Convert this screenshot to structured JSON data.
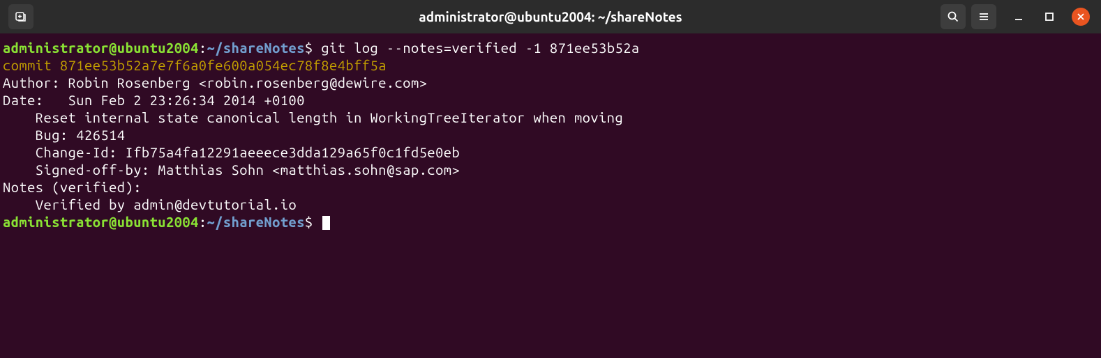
{
  "titlebar": {
    "title": "administrator@ubuntu2004: ~/shareNotes"
  },
  "prompt": {
    "user_host": "administrator@ubuntu2004",
    "colon": ":",
    "path": "~/shareNotes",
    "dollar": "$"
  },
  "command": " git log --notes=verified -1 871ee53b52a",
  "output": {
    "commit": "commit 871ee53b52a7e7f6a0fe600a054ec78f8e4bff5a",
    "author": "Author: Robin Rosenberg <robin.rosenberg@dewire.com>",
    "date": "Date:   Sun Feb 2 23:26:34 2014 +0100",
    "blank1": "",
    "msg1": "    Reset internal state canonical length in WorkingTreeIterator when moving",
    "blank2": "",
    "msg2": "    Bug: 426514",
    "msg3": "    Change-Id: Ifb75a4fa12291aeeece3dda129a65f0c1fd5e0eb",
    "msg4": "    Signed-off-by: Matthias Sohn <matthias.sohn@sap.com>",
    "blank3": "",
    "notes_header": "Notes (verified):",
    "notes_content": "    Verified by admin@devtutorial.io"
  }
}
